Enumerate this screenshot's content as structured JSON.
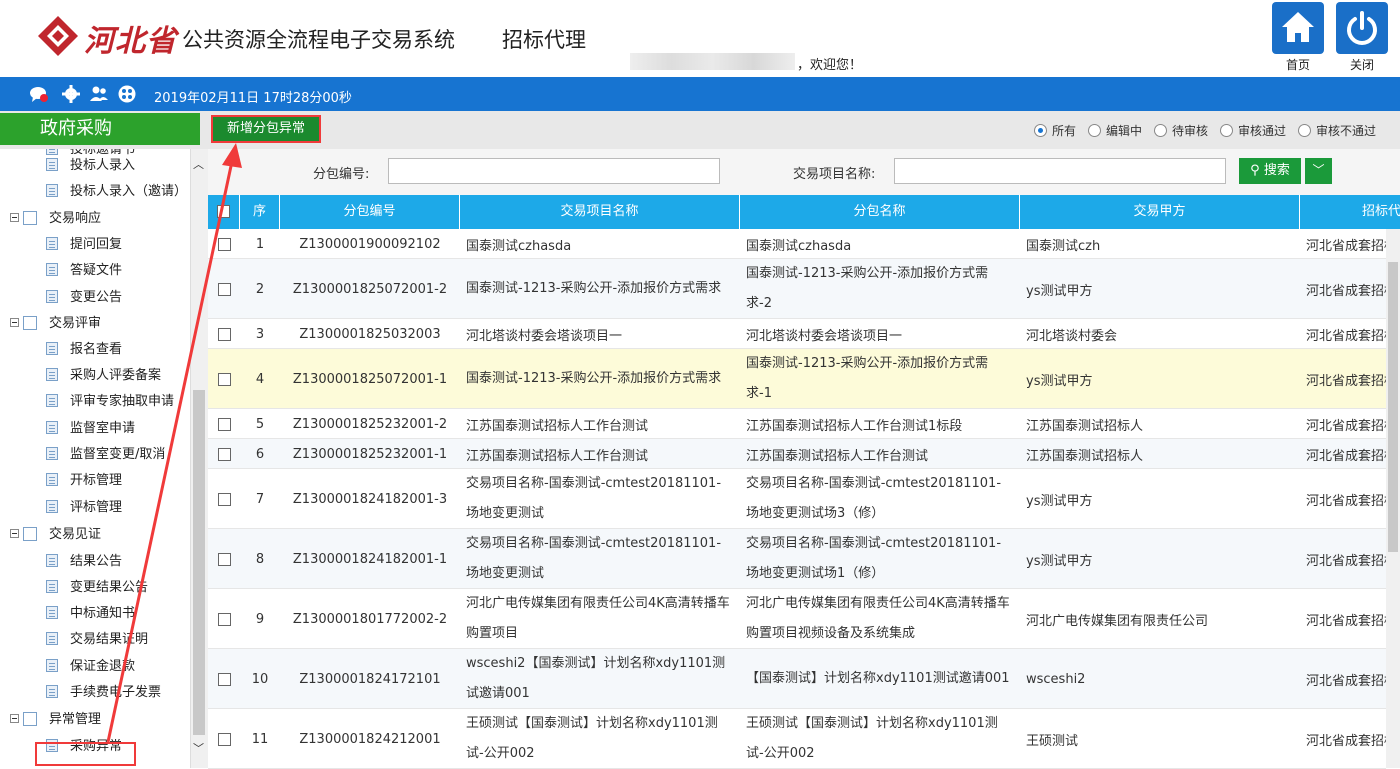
{
  "header": {
    "logo_text": "河北省",
    "system_name": "公共资源全流程电子交易系统",
    "role": "招标代理",
    "welcome": "，欢迎您！",
    "home_label": "首页",
    "close_label": "关闭",
    "datetime": "2019年02月11日 17时28分00秒"
  },
  "module": "政府采购",
  "toolbar": {
    "add_label": "新增分包异常"
  },
  "filters": [
    {
      "label": "所有",
      "checked": true
    },
    {
      "label": "编辑中",
      "checked": false
    },
    {
      "label": "待审核",
      "checked": false
    },
    {
      "label": "审核通过",
      "checked": false
    },
    {
      "label": "审核不通过",
      "checked": false
    }
  ],
  "search": {
    "package_label": "分包编号:",
    "project_label": "交易项目名称:",
    "button_label": "搜索",
    "dropdown": "﹀"
  },
  "sidebar": {
    "items": [
      {
        "label": "投标邀请书",
        "type": "leaf"
      },
      {
        "label": "投标人录入",
        "type": "leaf"
      },
      {
        "label": "投标人录入（邀请）",
        "type": "leaf"
      },
      {
        "label": "交易响应",
        "type": "group"
      },
      {
        "label": "提问回复",
        "type": "leaf"
      },
      {
        "label": "答疑文件",
        "type": "leaf"
      },
      {
        "label": "变更公告",
        "type": "leaf"
      },
      {
        "label": "交易评审",
        "type": "group"
      },
      {
        "label": "报名查看",
        "type": "leaf"
      },
      {
        "label": "采购人评委备案",
        "type": "leaf"
      },
      {
        "label": "评审专家抽取申请",
        "type": "leaf"
      },
      {
        "label": "监督室申请",
        "type": "leaf"
      },
      {
        "label": "监督室变更/取消",
        "type": "leaf"
      },
      {
        "label": "开标管理",
        "type": "leaf"
      },
      {
        "label": "评标管理",
        "type": "leaf"
      },
      {
        "label": "交易见证",
        "type": "group"
      },
      {
        "label": "结果公告",
        "type": "leaf"
      },
      {
        "label": "变更结果公告",
        "type": "leaf"
      },
      {
        "label": "中标通知书",
        "type": "leaf"
      },
      {
        "label": "交易结果证明",
        "type": "leaf"
      },
      {
        "label": "保证金退款",
        "type": "leaf"
      },
      {
        "label": "手续费电子发票",
        "type": "leaf"
      },
      {
        "label": "异常管理",
        "type": "group"
      },
      {
        "label": "采购异常",
        "type": "leaf"
      }
    ]
  },
  "table": {
    "columns": [
      "序",
      "分包编号",
      "交易项目名称",
      "分包名称",
      "交易甲方",
      "招标代"
    ],
    "rows": [
      {
        "no": "1",
        "code": "Z1300001900092102",
        "project": "国泰测试czhasda",
        "package": "国泰测试czhasda",
        "party": "国泰测试czh",
        "agent": "河北省成套招标"
      },
      {
        "no": "2",
        "code": "Z1300001825072001-2",
        "project": "国泰测试-1213-采购公开-添加报价方式需求",
        "package": "国泰测试-1213-采购公开-添加报价方式需求-2",
        "party": "ys测试甲方",
        "agent": "河北省成套招标"
      },
      {
        "no": "3",
        "code": "Z1300001825032003",
        "project": "河北塔谈村委会塔谈项目一",
        "package": "河北塔谈村委会塔谈项目一",
        "party": "河北塔谈村委会",
        "agent": "河北省成套招标"
      },
      {
        "no": "4",
        "code": "Z1300001825072001-1",
        "project": "国泰测试-1213-采购公开-添加报价方式需求",
        "package": "国泰测试-1213-采购公开-添加报价方式需求-1",
        "party": "ys测试甲方",
        "agent": "河北省成套招标"
      },
      {
        "no": "5",
        "code": "Z1300001825232001-2",
        "project": "江苏国泰测试招标人工作台测试",
        "package": "江苏国泰测试招标人工作台测试1标段",
        "party": "江苏国泰测试招标人",
        "agent": "河北省成套招标"
      },
      {
        "no": "6",
        "code": "Z1300001825232001-1",
        "project": "江苏国泰测试招标人工作台测试",
        "package": "江苏国泰测试招标人工作台测试",
        "party": "江苏国泰测试招标人",
        "agent": "河北省成套招标"
      },
      {
        "no": "7",
        "code": "Z1300001824182001-3",
        "project": "交易项目名称-国泰测试-cmtest20181101-场地变更测试",
        "package": "交易项目名称-国泰测试-cmtest20181101-场地变更测试场3（修）",
        "party": "ys测试甲方",
        "agent": "河北省成套招标"
      },
      {
        "no": "8",
        "code": "Z1300001824182001-1",
        "project": "交易项目名称-国泰测试-cmtest20181101-场地变更测试",
        "package": "交易项目名称-国泰测试-cmtest20181101-场地变更测试场1（修）",
        "party": "ys测试甲方",
        "agent": "河北省成套招标"
      },
      {
        "no": "9",
        "code": "Z1300001801772002-2",
        "project": "河北广电传媒集团有限责任公司4K高清转播车购置项目",
        "package": "河北广电传媒集团有限责任公司4K高清转播车购置项目视频设备及系统集成",
        "party": "河北广电传媒集团有限责任公司",
        "agent": "河北省成套招标"
      },
      {
        "no": "10",
        "code": "Z1300001824172101",
        "project": "wsceshi2【国泰测试】计划名称xdy1101测试邀请001",
        "package": "【国泰测试】计划名称xdy1101测试邀请001",
        "party": "wsceshi2",
        "agent": "河北省成套招标"
      },
      {
        "no": "11",
        "code": "Z1300001824212001",
        "project": "王硕测试【国泰测试】计划名称xdy1101测试-公开002",
        "package": "王硕测试【国泰测试】计划名称xdy1101测试-公开002",
        "party": "王硕测试",
        "agent": "河北省成套招标"
      }
    ]
  },
  "colors": {
    "accent": "#1774d1",
    "header_row": "#1da9e8",
    "green": "#2ca22c",
    "highlight_row": "#fdfbd9",
    "annotation": "#f03a3a"
  }
}
